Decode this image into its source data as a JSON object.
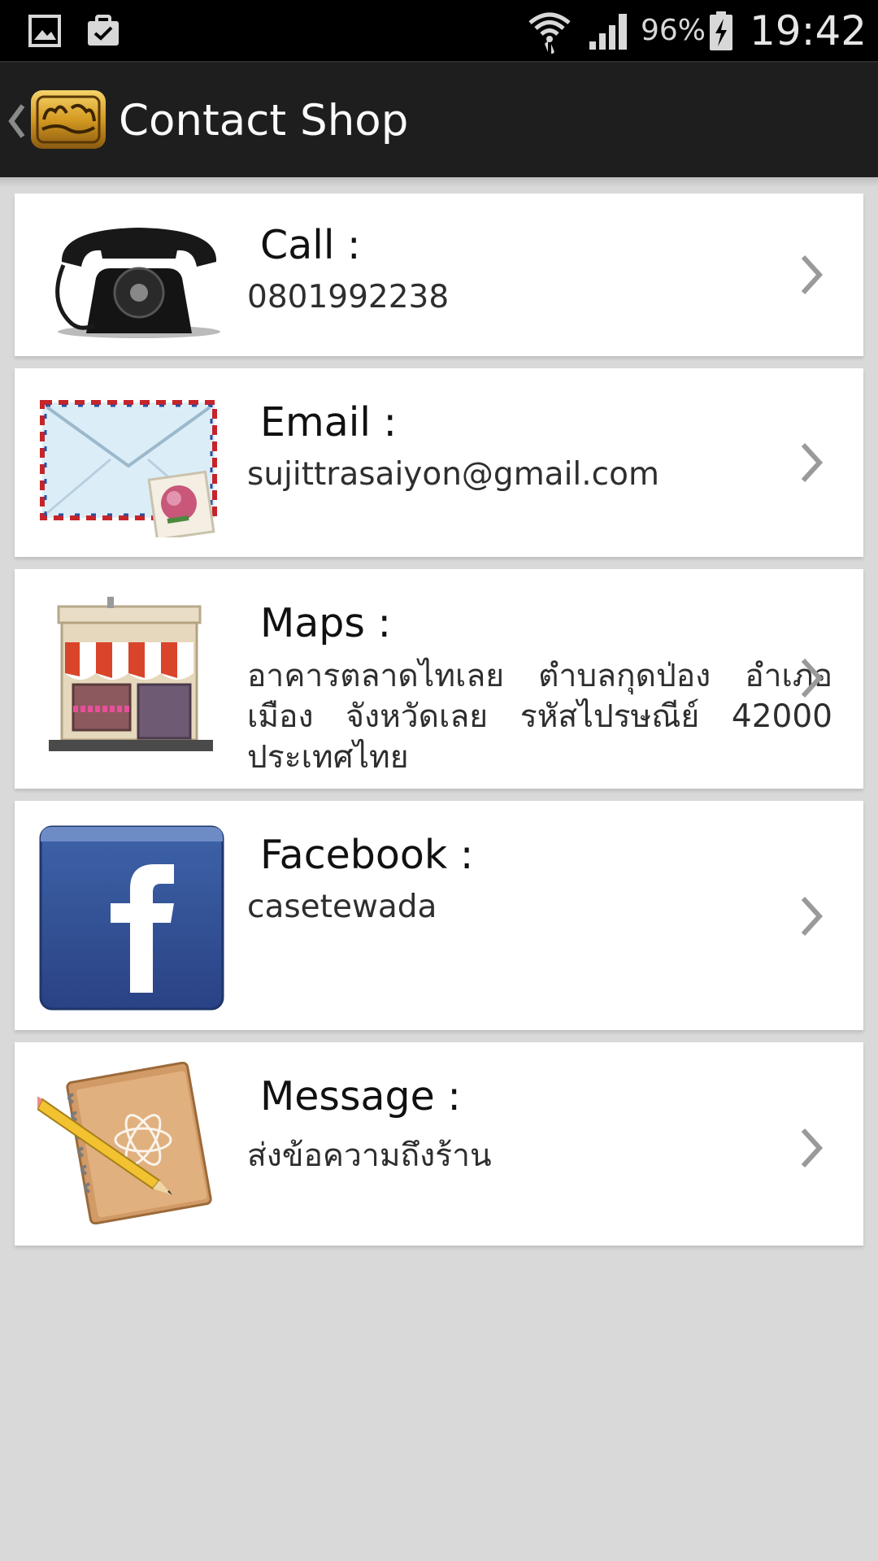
{
  "status_bar": {
    "battery": "96%",
    "time": "19:42",
    "icons": [
      "gallery-icon",
      "clipboard-check-icon",
      "wifi-icon",
      "signal-icon",
      "battery-charging-icon"
    ]
  },
  "app_bar": {
    "title": "Contact Shop",
    "back_icon": "chevron-left-icon"
  },
  "contacts": [
    {
      "label": "Call :",
      "value": "0801992238",
      "icon": "telephone-icon"
    },
    {
      "label": "Email :",
      "value": "sujittrasaiyon@gmail.com",
      "icon": "envelope-icon"
    },
    {
      "label": "Maps :",
      "value": "อาคารตลาดไทเลย ตำบลกุดป่อง อำเภอเมือง จังหวัดเลย รหัสไปรษณีย์ 42000 ประเทศไทย",
      "icon": "storefront-icon"
    },
    {
      "label": "Facebook :",
      "value": "casetewada",
      "icon": "facebook-icon"
    },
    {
      "label": "Message :",
      "value": "ส่งข้อความถึงร้าน",
      "icon": "notepad-icon"
    }
  ],
  "colors": {
    "status_bar": "#000000",
    "app_bar": "#1e1e1e",
    "background": "#d9d9d9",
    "card": "#ffffff",
    "facebook": "#3b5998"
  }
}
